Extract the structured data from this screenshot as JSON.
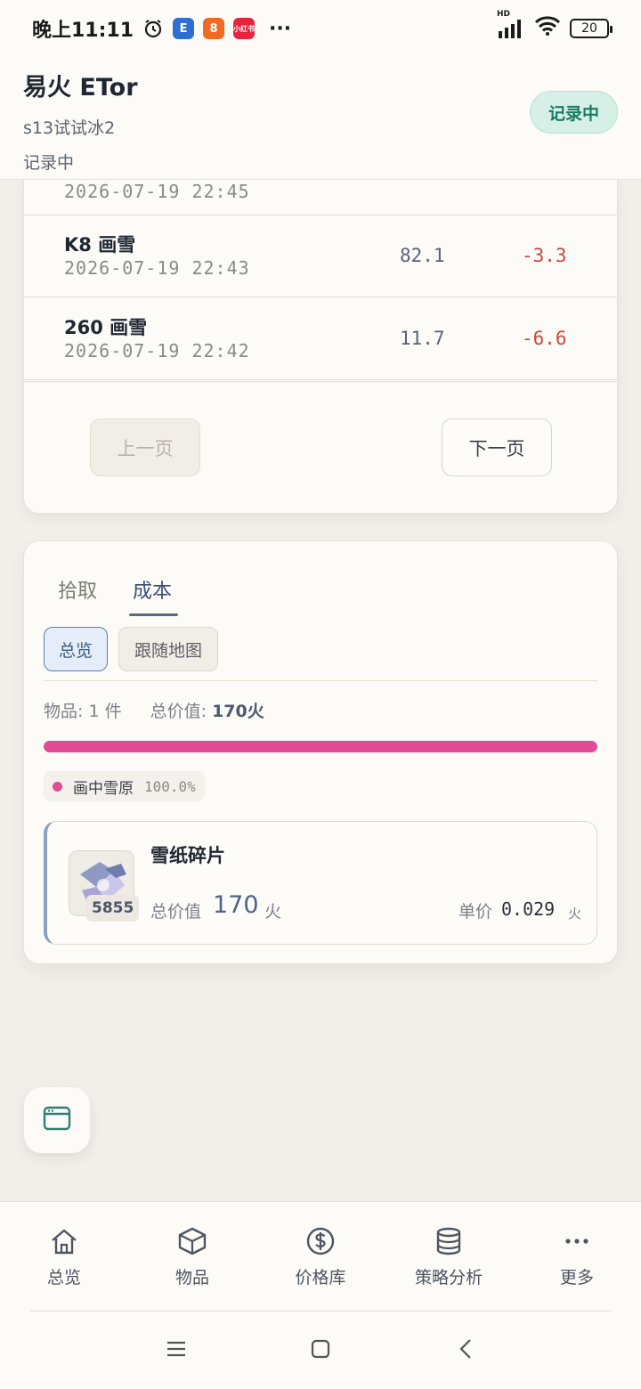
{
  "status_bar": {
    "time": "晚上11:11",
    "app1": "E",
    "app2": "8",
    "app3": "小红书",
    "more": "···",
    "network": "HD",
    "battery": "20"
  },
  "header": {
    "app_title": "易火 ETor",
    "session_name": "s13试试冰2",
    "status_text": "记录中",
    "recording_pill": "记录中"
  },
  "records": {
    "partial_row": {
      "date": "2026-07-19 22:45"
    },
    "rows": [
      {
        "name": "K8 画雪",
        "date": "2026-07-19 22:43",
        "value": "82.1",
        "delta": "-3.3"
      },
      {
        "name": "260 画雪",
        "date": "2026-07-19 22:42",
        "value": "11.7",
        "delta": "-6.6"
      }
    ],
    "prev_label": "上一页",
    "next_label": "下一页"
  },
  "cost_panel": {
    "tabs": [
      "拾取",
      "成本"
    ],
    "active_tab": "成本",
    "chips": [
      "总览",
      "跟随地图"
    ],
    "active_chip": "总览",
    "items_label": "物品: 1 件",
    "total_label": "总价值:",
    "total_value": "170火",
    "distribution": [
      {
        "name": "画中雪原",
        "pct_text": "100.0%",
        "fraction": 1.0,
        "color": "#e14a94"
      }
    ],
    "item": {
      "name": "雪纸碎片",
      "quantity": "5855",
      "total_label": "总价值",
      "total_value": "170",
      "total_unit": "火",
      "unit_label": "单价",
      "unit_value": "0.029",
      "unit_unit": "火"
    }
  },
  "bottom_nav": [
    {
      "label": "总览",
      "icon": "home-icon"
    },
    {
      "label": "物品",
      "icon": "box-icon"
    },
    {
      "label": "价格库",
      "icon": "dollar-icon"
    },
    {
      "label": "策略分析",
      "icon": "database-icon"
    },
    {
      "label": "更多",
      "icon": "more-icon"
    }
  ],
  "colors": {
    "accent": "#4d6488",
    "negative": "#c94a3b",
    "recording": "#1d7a62",
    "bar": "#e14a94"
  }
}
